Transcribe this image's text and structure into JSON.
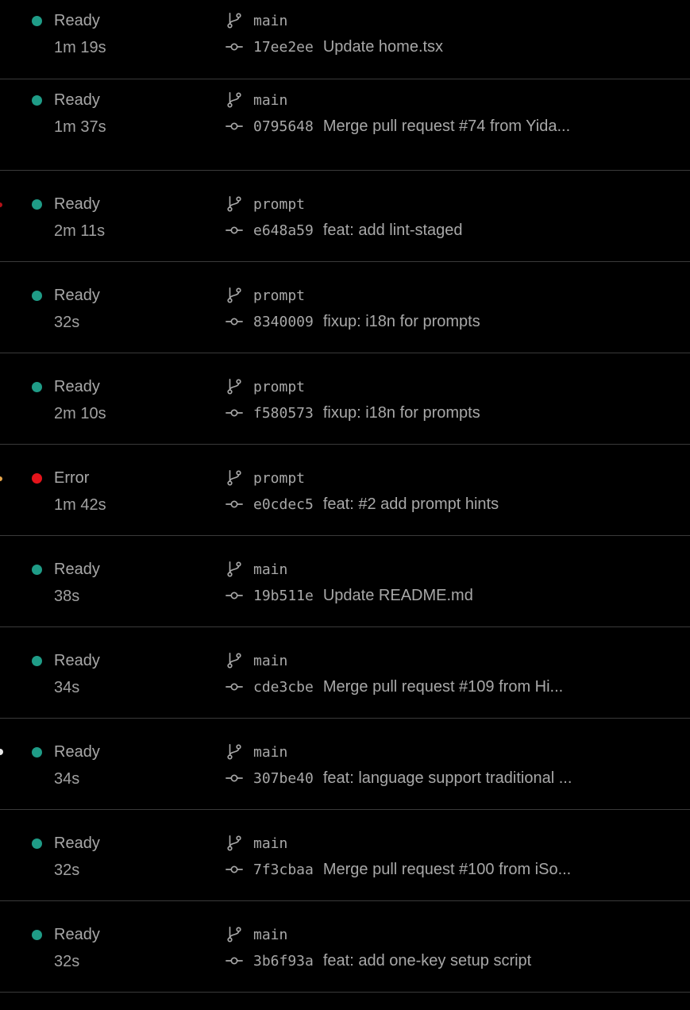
{
  "colors": {
    "ready": "#1f9c87",
    "error": "#e5141b"
  },
  "icons": {
    "branch": "git-branch-icon",
    "commit": "git-commit-icon"
  },
  "deployments": [
    {
      "status": "Ready",
      "duration": "1m 19s",
      "branch": "main",
      "sha": "17ee2ee",
      "message": "Update home.tsx"
    },
    {
      "status": "Ready",
      "duration": "1m 37s",
      "branch": "main",
      "sha": "0795648",
      "message": "Merge pull request #74 from Yida..."
    },
    {
      "status": "Ready",
      "duration": "2m 11s",
      "branch": "prompt",
      "sha": "e648a59",
      "message": "feat: add lint-staged"
    },
    {
      "status": "Ready",
      "duration": "32s",
      "branch": "prompt",
      "sha": "8340009",
      "message": "fixup: i18n for prompts"
    },
    {
      "status": "Ready",
      "duration": "2m 10s",
      "branch": "prompt",
      "sha": "f580573",
      "message": "fixup: i18n for prompts"
    },
    {
      "status": "Error",
      "duration": "1m 42s",
      "branch": "prompt",
      "sha": "e0cdec5",
      "message": "feat: #2 add prompt hints"
    },
    {
      "status": "Ready",
      "duration": "38s",
      "branch": "main",
      "sha": "19b511e",
      "message": "Update README.md"
    },
    {
      "status": "Ready",
      "duration": "34s",
      "branch": "main",
      "sha": "cde3cbe",
      "message": "Merge pull request #109 from Hi..."
    },
    {
      "status": "Ready",
      "duration": "34s",
      "branch": "main",
      "sha": "307be40",
      "message": "feat: language support traditional ..."
    },
    {
      "status": "Ready",
      "duration": "32s",
      "branch": "main",
      "sha": "7f3cbaa",
      "message": "Merge pull request #100 from iSo..."
    },
    {
      "status": "Ready",
      "duration": "32s",
      "branch": "main",
      "sha": "3b6f93a",
      "message": "feat: add one-key setup script"
    }
  ]
}
